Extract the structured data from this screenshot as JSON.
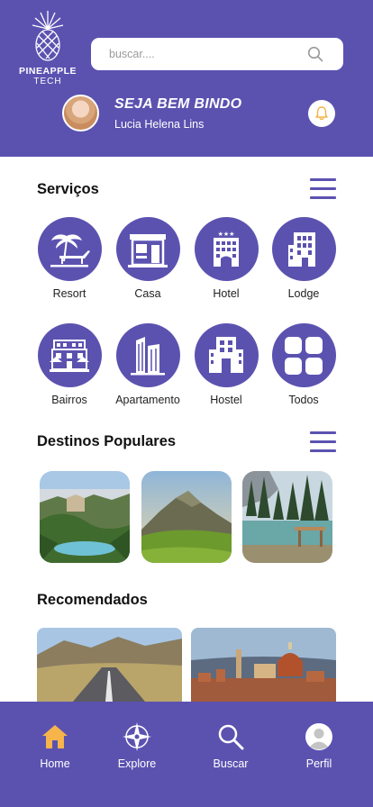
{
  "brand": {
    "line1": "PINEAPPLE",
    "line2": "TECH"
  },
  "search": {
    "placeholder": "buscar...."
  },
  "user": {
    "greeting": "SEJA BEM BINDO",
    "name": "Lucia Helena Lins"
  },
  "services": {
    "title": "Serviços",
    "items": [
      {
        "label": "Resort",
        "icon": "resort-icon"
      },
      {
        "label": "Casa",
        "icon": "house-icon"
      },
      {
        "label": "Hotel",
        "icon": "hotel-icon"
      },
      {
        "label": "Lodge",
        "icon": "lodge-icon"
      },
      {
        "label": "Bairros",
        "icon": "neighborhood-icon"
      },
      {
        "label": "Apartamento",
        "icon": "apartment-icon"
      },
      {
        "label": "Hostel",
        "icon": "hostel-icon"
      },
      {
        "label": "Todos",
        "icon": "grid-icon"
      }
    ]
  },
  "popular": {
    "title": "Destinos Populares"
  },
  "recommended": {
    "title": "Recomendados"
  },
  "nav": {
    "items": [
      {
        "label": "Home",
        "icon": "home-icon",
        "active": true
      },
      {
        "label": "Explore",
        "icon": "compass-icon"
      },
      {
        "label": "Buscar",
        "icon": "search-icon"
      },
      {
        "label": "Perfil",
        "icon": "profile-icon"
      }
    ]
  },
  "colors": {
    "primary": "#5b52b0",
    "active": "#f6b44a",
    "white": "#ffffff"
  }
}
